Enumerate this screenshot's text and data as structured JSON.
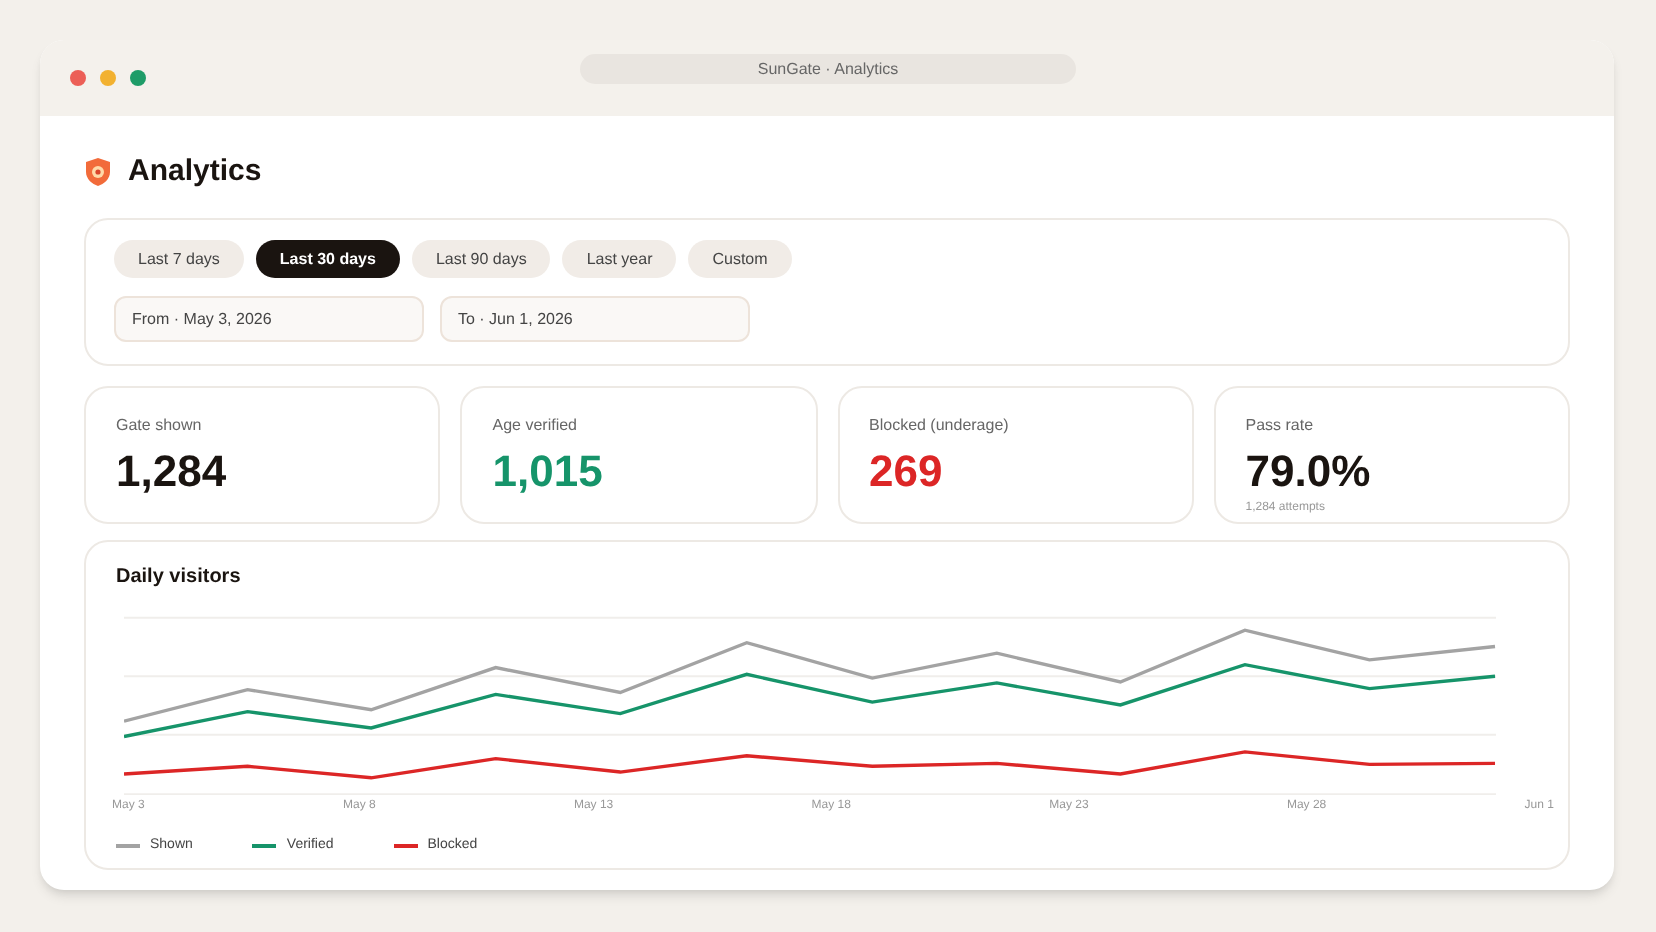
{
  "window": {
    "title": "SunGate · Analytics"
  },
  "page": {
    "title": "Analytics"
  },
  "ranges": [
    {
      "label": "Last 7 days",
      "selected": false
    },
    {
      "label": "Last 30 days",
      "selected": true
    },
    {
      "label": "Last 90 days",
      "selected": false
    },
    {
      "label": "Last year",
      "selected": false
    },
    {
      "label": "Custom",
      "selected": false
    }
  ],
  "dates": [
    {
      "value": "From · May 3, 2026"
    },
    {
      "value": "To · Jun 1, 2026"
    }
  ],
  "stats": [
    {
      "label": "Gate shown",
      "value": "1,284",
      "color": "#1a1410"
    },
    {
      "label": "Age verified",
      "value": "1,015",
      "color": "#16946a"
    },
    {
      "label": "Blocked (underage)",
      "value": "269",
      "color": "#dc2626"
    },
    {
      "label": "Pass rate",
      "value": "79.0%",
      "color": "#1a1410",
      "note": "1,284 attempts"
    }
  ],
  "chart": {
    "title": "Daily visitors",
    "x_labels": [
      "May 3",
      "May 8",
      "May 13",
      "May 18",
      "May 23",
      "May 28",
      "Jun 1"
    ],
    "legend": [
      {
        "label": "Shown",
        "color": "#a3a3a3"
      },
      {
        "label": "Verified",
        "color": "#16946a"
      },
      {
        "label": "Blocked",
        "color": "#dc2626"
      }
    ]
  }
}
